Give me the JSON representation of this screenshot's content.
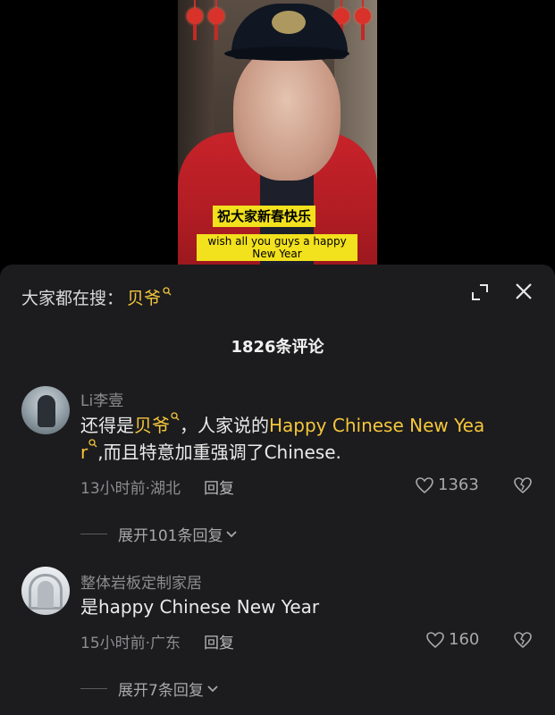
{
  "video": {
    "subtitle_cn": "祝大家新春快乐",
    "subtitle_en": "wish all you guys a happy New Year"
  },
  "search": {
    "prefix": "大家都在搜：",
    "term": "贝爷"
  },
  "comments_title": "1826条评论",
  "comments": [
    {
      "username": "Li李壹",
      "text_pre": "还得是",
      "text_hl1": "贝爷",
      "text_mid": "，人家说的",
      "text_hl2": "Happy Chinese New Yea",
      "text_hl2b": "r",
      "text_post": ",而且特意加重强调了Chinese.",
      "time_location": "13小时前·湖北",
      "reply_label": "回复",
      "likes": "1363",
      "expand_label": "展开101条回复"
    },
    {
      "username": "整体岩板定制家居",
      "text": "是happy Chinese New Year",
      "time_location": "15小时前·广东",
      "reply_label": "回复",
      "likes": "160",
      "expand_label": "展开7条回复"
    }
  ],
  "colors": {
    "sheet_bg": "#1c1c1e",
    "highlight": "#f5c63c",
    "subtitle_bg": "#f2e11d"
  },
  "icons": [
    "search-mini-icon",
    "minimize-icon",
    "close-icon",
    "heart-icon",
    "dislike-icon",
    "chevron-down-icon"
  ]
}
